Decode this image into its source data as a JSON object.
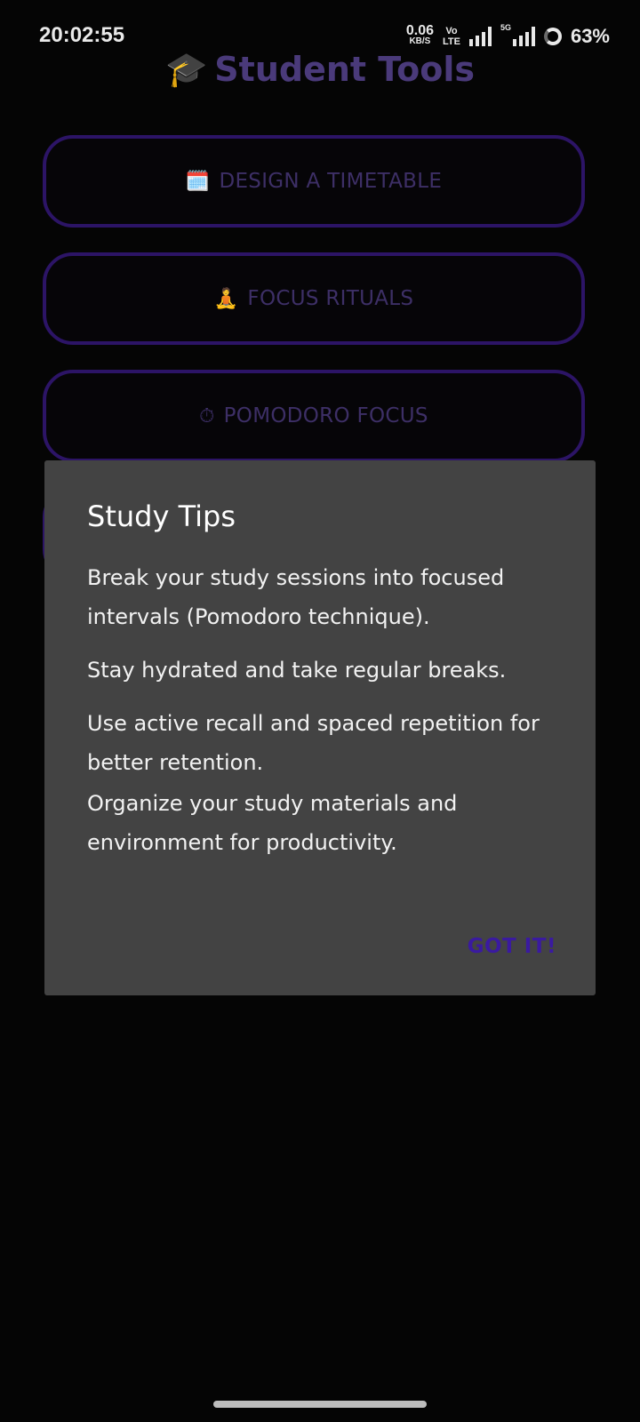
{
  "status_bar": {
    "time": "20:02:55",
    "net_speed_value": "0.06",
    "net_speed_unit": "KB/S",
    "volte_top": "Vo",
    "volte_bottom": "LTE",
    "network_5g": "5G",
    "battery": "63%"
  },
  "app": {
    "title": "Student Tools",
    "title_icon": "🎓"
  },
  "menu": [
    {
      "icon": "🗓️",
      "label": "DESIGN A TIMETABLE"
    },
    {
      "icon": "🧘",
      "label": "FOCUS RITUALS"
    },
    {
      "icon": "⏱",
      "label": "POMODORO FOCUS"
    },
    {
      "icon": "",
      "label": ""
    }
  ],
  "dialog": {
    "title": "Study Tips",
    "tips": [
      "Break your study sessions into focused intervals (Pomodoro technique).",
      "Stay hydrated and take regular breaks.",
      "Use active recall and spaced repetition for better retention.",
      "Organize your study materials and environment for productivity."
    ],
    "action_label": "GOT IT!"
  },
  "colors": {
    "background": "#050505",
    "accent_purple": "#2c1466",
    "dialog_bg": "#434343",
    "action_text": "#3a1aa0"
  }
}
